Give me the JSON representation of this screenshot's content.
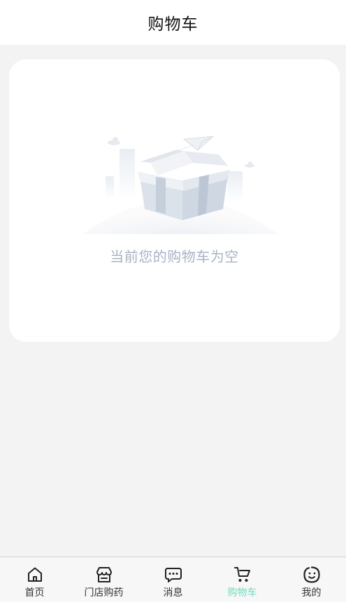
{
  "header": {
    "title": "购物车"
  },
  "cart": {
    "empty_message": "当前您的购物车为空",
    "illustration": "empty-box-illustration"
  },
  "tabbar": {
    "active_tab": "cart",
    "active_color": "#6fdcc0",
    "items": [
      {
        "id": "home",
        "label": "首页",
        "icon": "home-icon"
      },
      {
        "id": "store",
        "label": "门店购药",
        "icon": "store-icon"
      },
      {
        "id": "messages",
        "label": "消息",
        "icon": "message-icon"
      },
      {
        "id": "cart",
        "label": "购物车",
        "icon": "cart-icon"
      },
      {
        "id": "mine",
        "label": "我的",
        "icon": "profile-face-icon"
      }
    ]
  }
}
